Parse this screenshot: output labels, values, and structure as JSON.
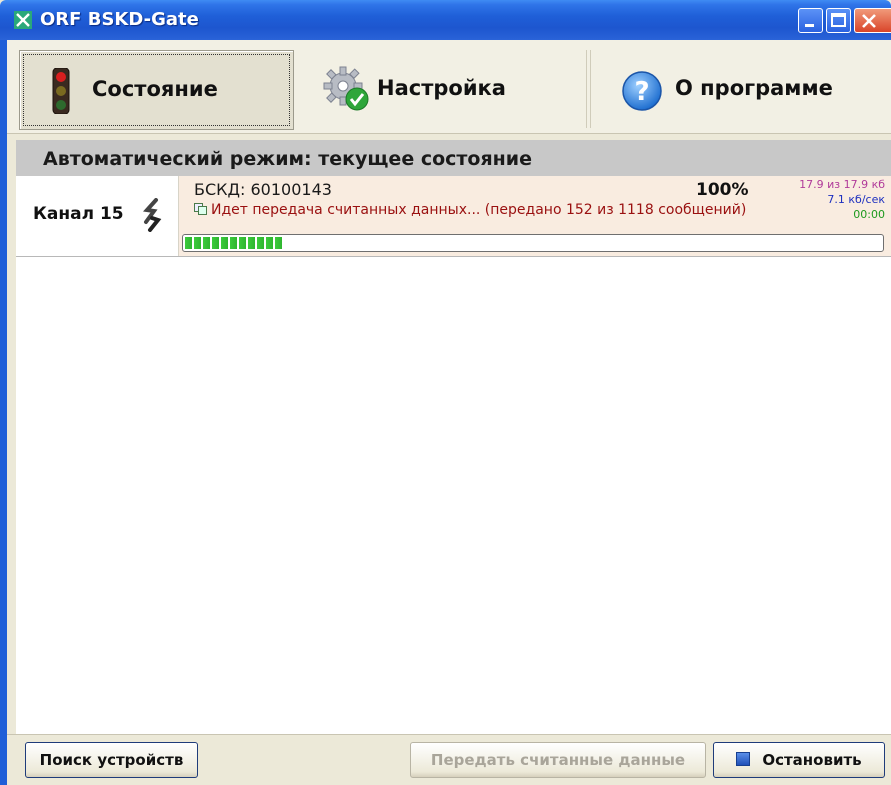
{
  "window": {
    "title": "ORF BSKD-Gate"
  },
  "tabs": [
    {
      "label": "Состояние",
      "icon": "traffic-light-icon",
      "active": true
    },
    {
      "label": "Настройка",
      "icon": "settings-gear-icon",
      "active": false
    },
    {
      "label": "О программе",
      "icon": "help-icon",
      "active": false
    }
  ],
  "section": {
    "title": "Автоматический режим: текущее состояние"
  },
  "channel": {
    "label": "Канал 15",
    "device": "БСКД: 60100143",
    "status": "Идет передача считанных данных... (передано 152 из 1118 сообщений)",
    "percent": "100%",
    "size": "17.9 из 17.9 кб",
    "speed": "7.1 кб/сек",
    "time": "00:00",
    "progress_fraction": 0.14
  },
  "buttons": {
    "find": "Поиск устройств",
    "transfer": "Передать считанные данные",
    "stop": "Остановить"
  },
  "colors": {
    "titlebar": "#1f5fd8",
    "status_text": "#9a1010",
    "progress": "#3ccb3c"
  }
}
